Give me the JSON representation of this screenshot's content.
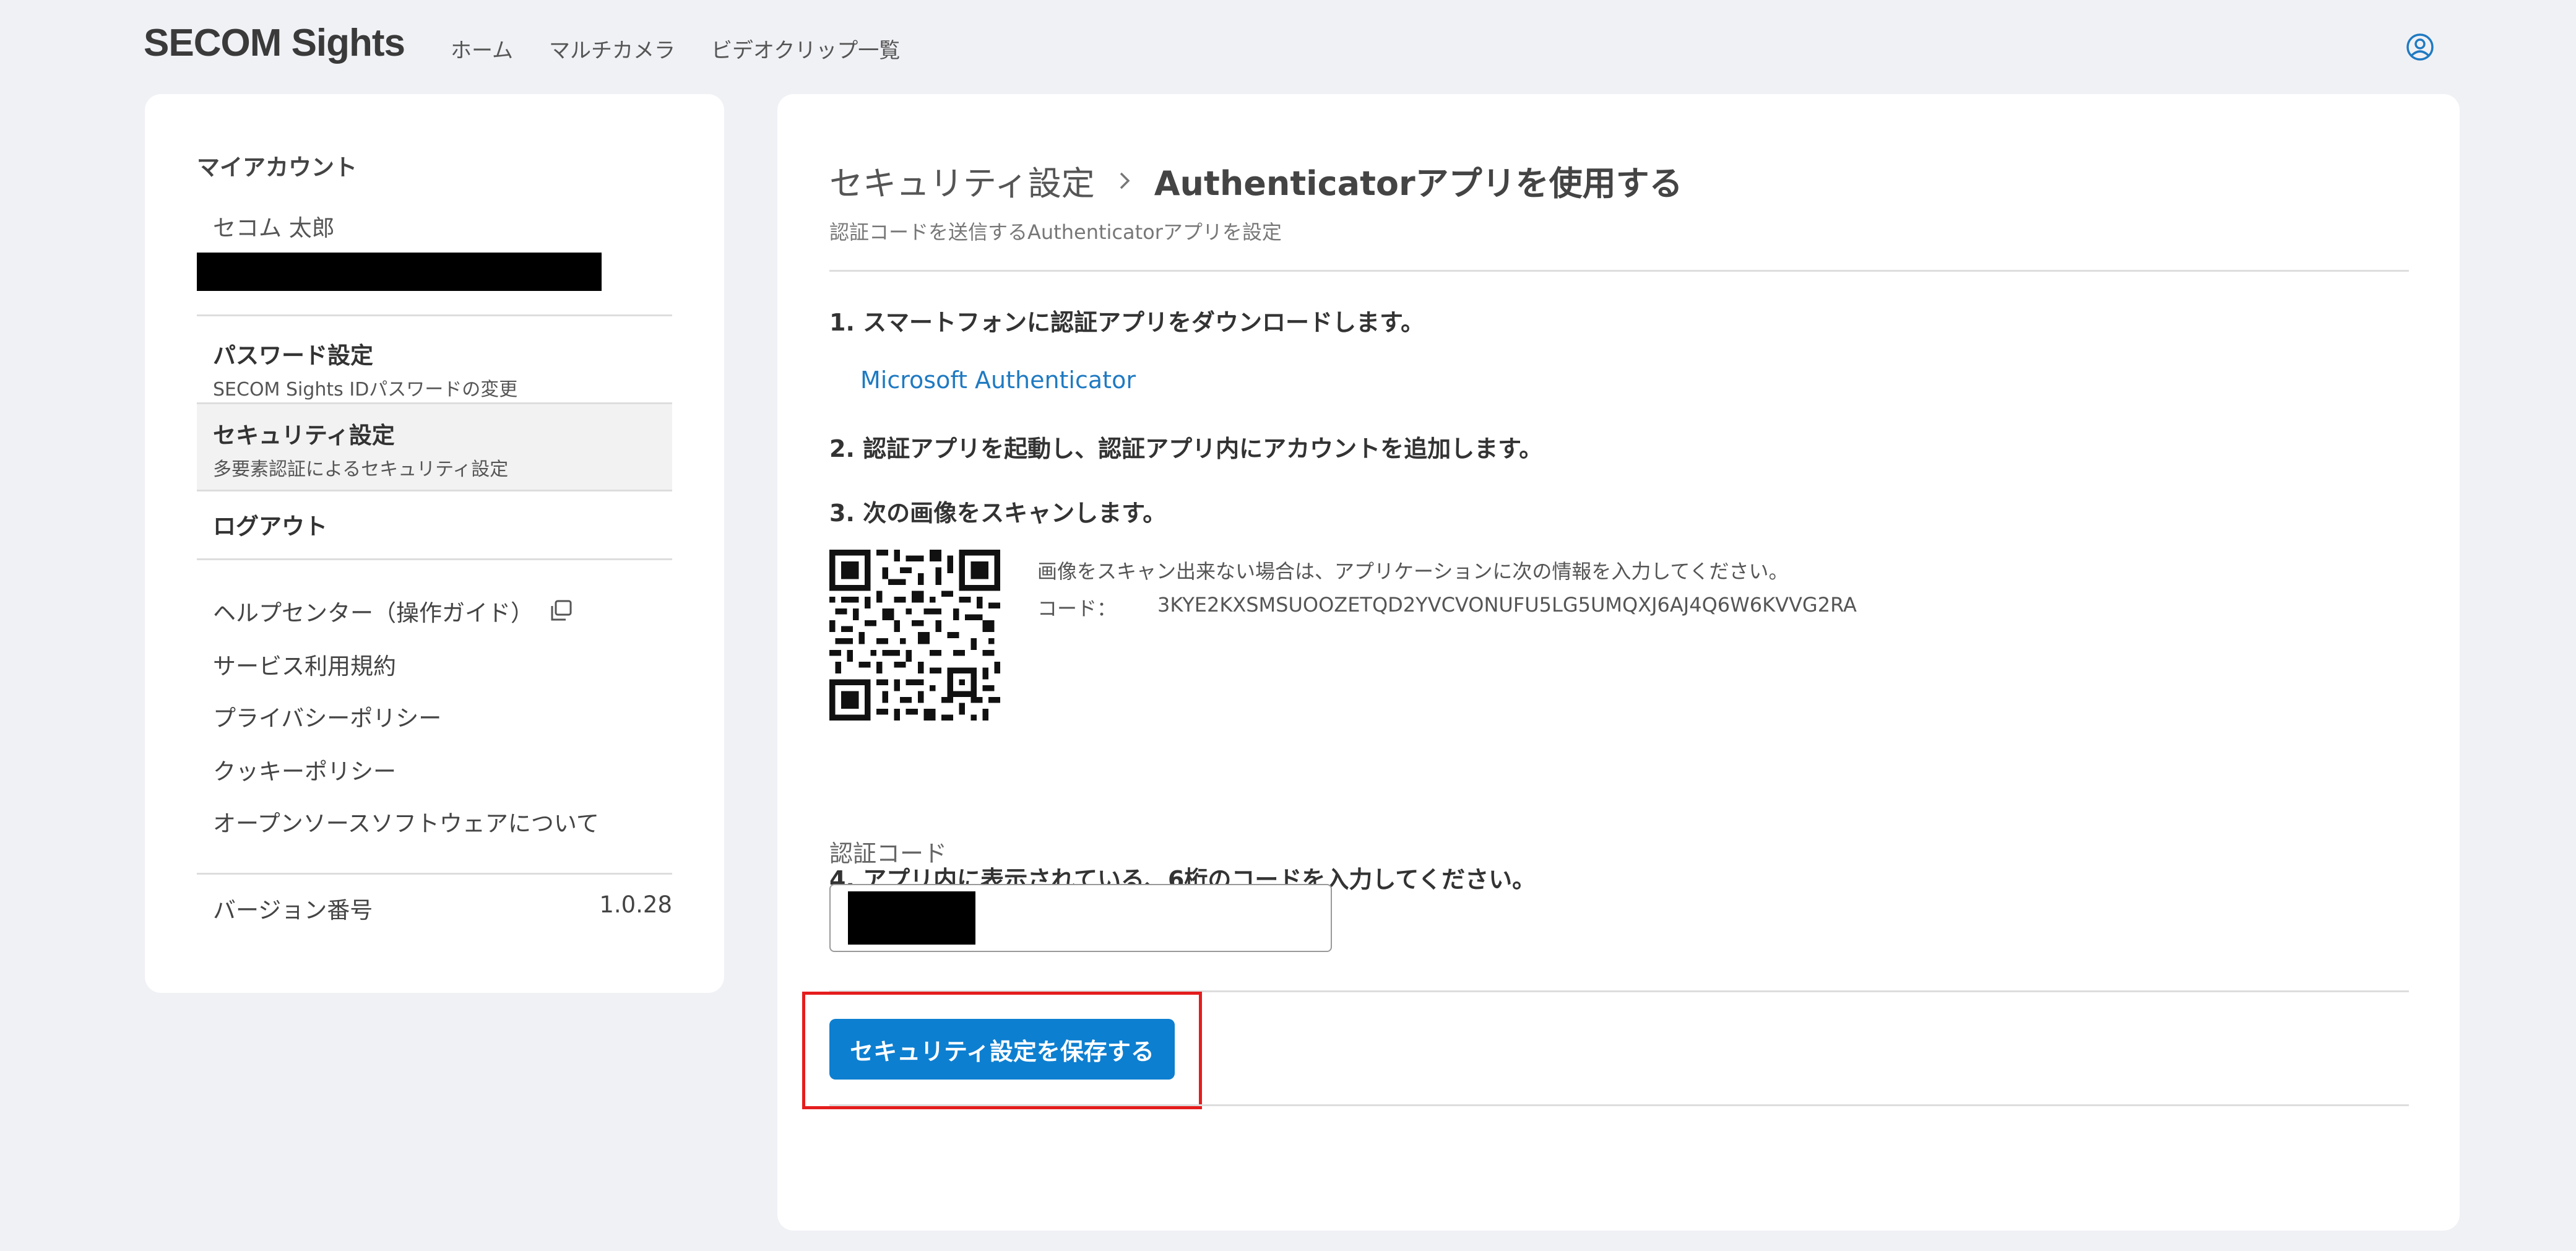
{
  "header": {
    "logo": "SECOM Sights",
    "nav": [
      "ホーム",
      "マルチカメラ",
      "ビデオクリップ一覧"
    ],
    "user_icon": "user-circle-icon"
  },
  "sidebar": {
    "section_title": "マイアカウント",
    "username": "セコム 太郎",
    "menu": [
      {
        "title": "パスワード設定",
        "subtitle": "SECOM Sights IDパスワードの変更"
      },
      {
        "title": "セキュリティ設定",
        "subtitle": "多要素認証によるセキュリティ設定"
      },
      {
        "title": "ログアウト"
      }
    ],
    "links": [
      "ヘルプセンター（操作ガイド）",
      "サービス利用規約",
      "プライバシーポリシー",
      "クッキーポリシー",
      "オープンソースソフトウェアについて"
    ],
    "external_icon": "external-link-icon",
    "version_label": "バージョン番号",
    "version_value": "1.0.28"
  },
  "main": {
    "breadcrumb_parent": "セキュリティ設定",
    "breadcrumb_current": "Authenticatorアプリを使用する",
    "subtitle": "認証コードを送信するAuthenticatorアプリを設定",
    "steps": [
      "1. スマートフォンに認証アプリをダウンロードします。",
      "2. 認証アプリを起動し、認証アプリ内にアカウントを追加します。",
      "3. 次の画像をスキャンします。",
      "4. アプリ内に表示されている、6桁のコードを入力してください。"
    ],
    "app_link": "Microsoft Authenticator",
    "qr_info": "画像をスキャン出来ない場合は、アプリケーションに次の情報を入力してください。",
    "code_label": "コード：",
    "code_value": "3KYE2KXSMSUOOZETQD2YVCVONUFU5LG5UMQXJ6AJ4Q6W6KVVG2RA",
    "field_label": "認証コード",
    "save_button": "セキュリティ設定を保存する",
    "colors": {
      "primary": "#0d7fd0",
      "link": "#1f7ac2",
      "highlight": "#e51d1d"
    }
  }
}
